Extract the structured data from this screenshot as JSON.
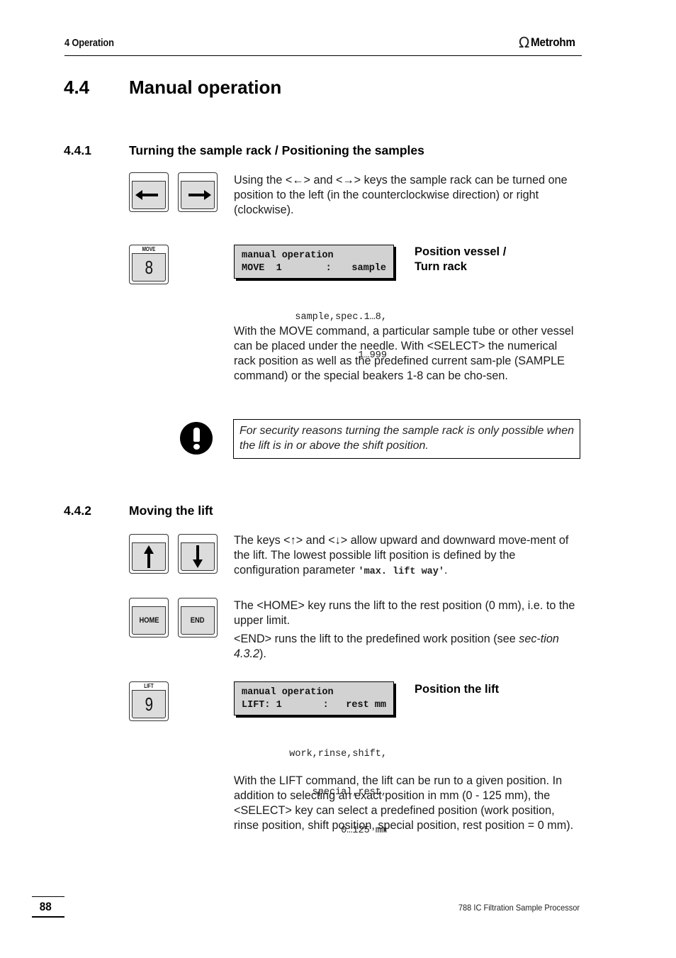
{
  "header": {
    "chapter": "4  Operation",
    "logo_icon": "omega-logo-icon",
    "brand": "Metrohm"
  },
  "section": {
    "number": "4.4",
    "title": "Manual operation"
  },
  "sub1": {
    "number": "4.4.1",
    "title": "Turning the sample rack / Positioning the samples",
    "keys": [
      {
        "icon": "arrow-left-icon"
      },
      {
        "icon": "arrow-right-icon"
      }
    ],
    "text_parts": [
      "Using the <",
      "←",
      "> and <",
      "→",
      "> keys the sample rack can be turned one position to the left (in the counterclockwise direction) or right (clockwise)."
    ],
    "move_key": {
      "cap": "MOVE",
      "digit": "8"
    },
    "display": {
      "line1": "manual operation",
      "line2_left": "MOVE  1",
      "line2_mid": ":",
      "line2_right": "sample"
    },
    "options": [
      "sample,spec.1…8,",
      "1…999"
    ],
    "side_title_1": "Position vessel /",
    "side_title_2": "Turn rack",
    "paragraph": "With the MOVE command, a particular sample tube or other vessel can be placed under the needle. With <SELECT> the numerical rack position as well as the predefined current sam-ple (SAMPLE command) or the special beakers 1-8 can be cho-sen.",
    "note": "For security reasons turning the sample rack is only possible when the lift is in or above the shift position.",
    "note_icon": "exclamation-icon"
  },
  "sub2": {
    "number": "4.4.2",
    "title": "Moving the lift",
    "keys": [
      {
        "icon": "arrow-up-icon"
      },
      {
        "icon": "arrow-down-icon"
      }
    ],
    "text1_a": "The keys <",
    "text1_b": "> and <",
    "text1_c": "> allow upward and downward move-ment of the lift. The lowest possible lift position is defined by the configuration parameter ",
    "text1_param": "'max. lift way'",
    "text1_end": ".",
    "home_key": "HOME",
    "end_key": "END",
    "text2": "The <HOME> key runs the lift to the rest position (0 mm), i.e. to the upper limit.",
    "text3_a": "<END> runs the lift to the predefined work position (see ",
    "text3_ref": "sec-tion 4.3.2",
    "text3_end": ").",
    "lift_key": {
      "cap": "LIFT",
      "digit": "9"
    },
    "display": {
      "line1": "manual operation",
      "line2_left": "LIFT: 1",
      "line2_mid": ":",
      "line2_right": "rest mm"
    },
    "options": [
      "work,rinse,shift,",
      "special,rest,",
      "0…125 mm"
    ],
    "side_title": "Position the lift",
    "paragraph": "With the LIFT command, the lift can be run to a given position. In addition to selecting an exact position in mm (0 - 125 mm), the <SELECT> key can select a predefined position (work position, rinse position, shift position, special position, rest position = 0 mm)."
  },
  "footer": {
    "page_number": "88",
    "product": "788 IC Filtration Sample Processor"
  }
}
